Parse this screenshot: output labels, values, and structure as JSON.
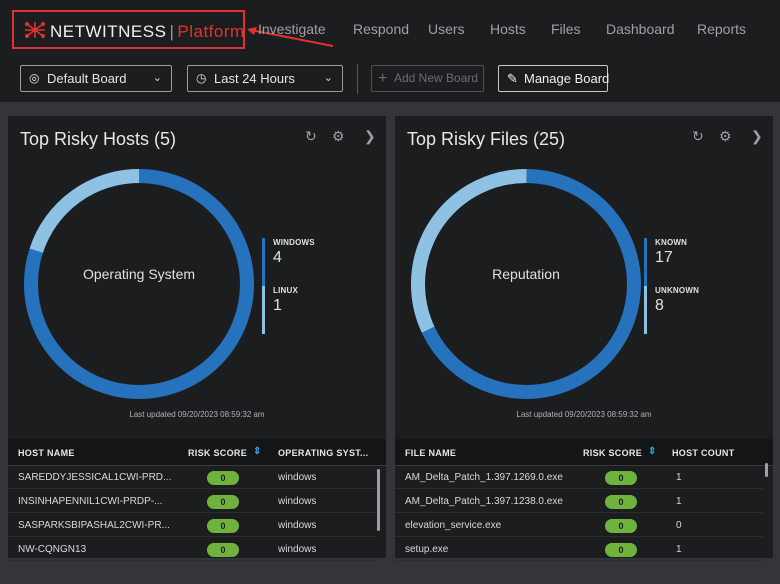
{
  "nav": {
    "brand": "NETWITNESS",
    "brand_sub": "Platform",
    "links": [
      "Investigate",
      "Respond",
      "Users",
      "Hosts",
      "Files",
      "Dashboard",
      "Reports"
    ]
  },
  "toolbar": {
    "board_select": "Default Board",
    "time_select": "Last 24 Hours",
    "add_board": "Add New Board",
    "manage_board": "Manage Board"
  },
  "hosts_panel": {
    "title": "Top Risky Hosts (5)",
    "center_label": "Operating System",
    "legend": [
      {
        "name": "WINDOWS",
        "count": "4"
      },
      {
        "name": "LINUX",
        "count": "1"
      }
    ],
    "updated": "Last updated 09/20/2023 08:59:32 am",
    "columns": [
      "HOST NAME",
      "RISK SCORE",
      "OPERATING SYST..."
    ],
    "rows": [
      {
        "name": "SAREDDYJESSICAL1CWI-PRD...",
        "score": "0",
        "os": "windows"
      },
      {
        "name": "INSINHAPENNIL1CWI-PRDP-...",
        "score": "0",
        "os": "windows"
      },
      {
        "name": "SASPARKSBIPASHAL2CWI-PR...",
        "score": "0",
        "os": "windows"
      },
      {
        "name": "NW-CQNGN13",
        "score": "0",
        "os": "windows"
      }
    ]
  },
  "files_panel": {
    "title": "Top Risky Files (25)",
    "center_label": "Reputation",
    "legend": [
      {
        "name": "KNOWN",
        "count": "17"
      },
      {
        "name": "UNKNOWN",
        "count": "8"
      }
    ],
    "updated": "Last updated 09/20/2023 08:59:32 am",
    "columns": [
      "FILE NAME",
      "RISK SCORE",
      "HOST COUNT"
    ],
    "rows": [
      {
        "name": "AM_Delta_Patch_1.397.1269.0.exe",
        "score": "0",
        "count": "1"
      },
      {
        "name": "AM_Delta_Patch_1.397.1238.0.exe",
        "score": "0",
        "count": "1"
      },
      {
        "name": "elevation_service.exe",
        "score": "0",
        "count": "0"
      },
      {
        "name": "setup.exe",
        "score": "0",
        "count": "1"
      }
    ]
  },
  "colors": {
    "accent_red": "#e0332f",
    "donut_dark": "#2772bd",
    "donut_light": "#8fc1e3",
    "score_green": "#6fb33c"
  }
}
